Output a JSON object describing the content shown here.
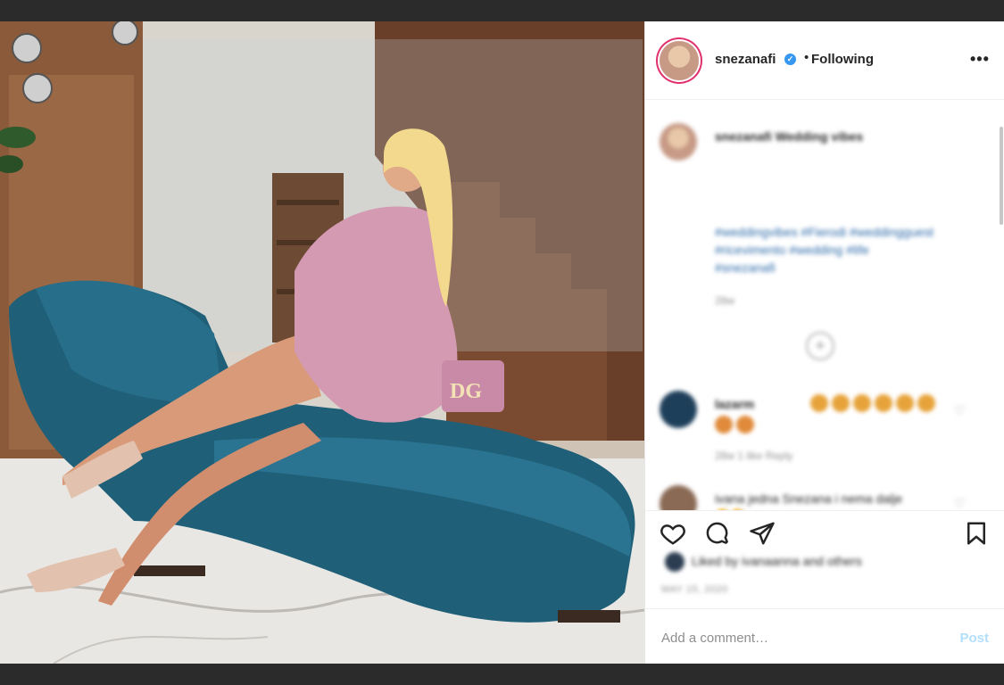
{
  "post": {
    "username": "snezanafi",
    "verified_mark": "✓",
    "separator": "•",
    "follow_state": "Following",
    "more_label": "•••"
  },
  "comments": {
    "caption_text": "snezanafi  Wedding vibes",
    "hashtags_line1": "#weddingvibes #Fierodi #weddingguest",
    "hashtags_line2": "#ricevimento #wedding #life",
    "hashtags_line3": "#snezanafi",
    "caption_time": "28w",
    "load_more": "+",
    "c1_text": "lazarm",
    "c1_meta": "28w  1 like  Reply",
    "c2_text": "ivana  jedna Snezana i nema dalje",
    "c2_emoji": "👏👏"
  },
  "actions": {
    "likes_text": "Liked by ivanaanna and others",
    "date_text": "MAY 15, 2020"
  },
  "add_comment": {
    "placeholder": "Add a comment…",
    "post_label": "Post"
  },
  "photo": {
    "bag_monogram": "DG"
  },
  "colors": {
    "accent": "#3897f0",
    "post_disabled": "#b2dffc",
    "chaise": "#1f5f78"
  }
}
